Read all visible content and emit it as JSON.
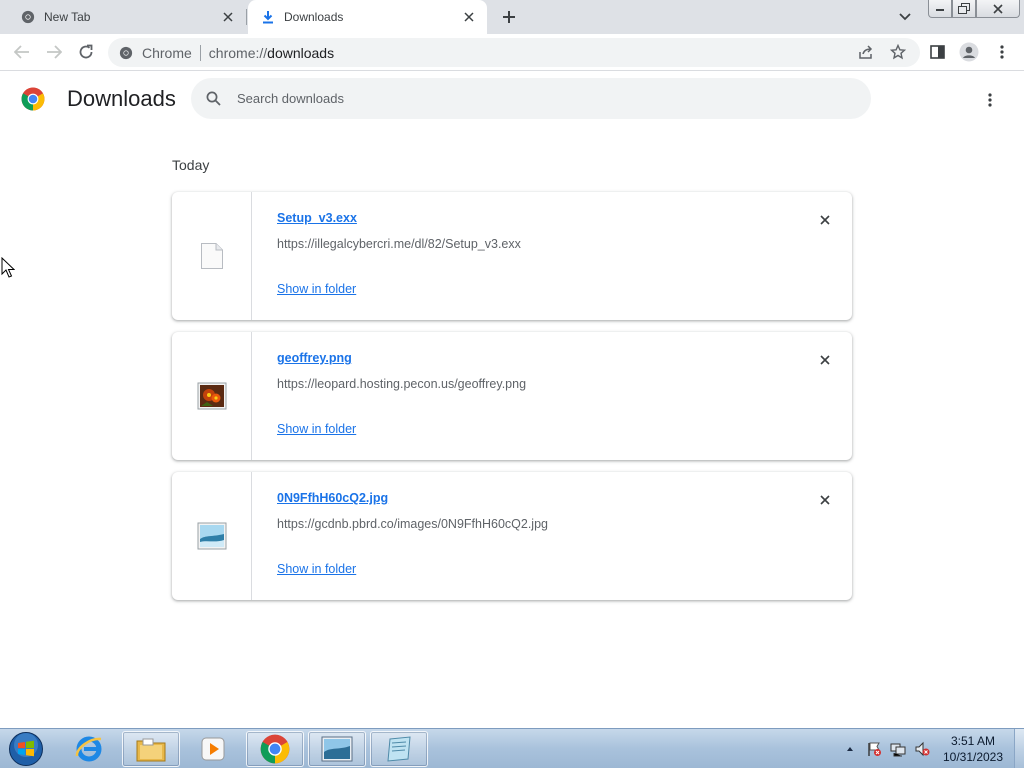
{
  "browser": {
    "tabs": [
      {
        "title": "New Tab",
        "active": false,
        "icon": "chrome-icon"
      },
      {
        "title": "Downloads",
        "active": true,
        "icon": "download-icon"
      }
    ],
    "omnibox": {
      "chip": "Chrome",
      "url_scheme": "chrome://",
      "url_host": "downloads"
    }
  },
  "downloads_page": {
    "title": "Downloads",
    "search_placeholder": "Search downloads",
    "date_group": "Today",
    "items": [
      {
        "filename": "Setup_v3.exx",
        "url": "https://illegalcybercri.me/dl/82/Setup_v3.exx",
        "action": "Show in folder",
        "icon": "generic-file-icon"
      },
      {
        "filename": "geoffrey.png",
        "url": "https://leopard.hosting.pecon.us/geoffrey.png",
        "action": "Show in folder",
        "icon": "image-file-icon"
      },
      {
        "filename": "0N9FfhH60cQ2.jpg",
        "url": "https://gcdnb.pbrd.co/images/0N9FfhH60cQ2.jpg",
        "action": "Show in folder",
        "icon": "image-file-icon"
      }
    ]
  },
  "taskbar": {
    "time": "3:51 AM",
    "date": "10/31/2023",
    "apps": [
      "internet-explorer-icon",
      "file-explorer-icon",
      "media-player-icon",
      "chrome-icon",
      "image-viewer-icon",
      "notepad-icon"
    ]
  }
}
